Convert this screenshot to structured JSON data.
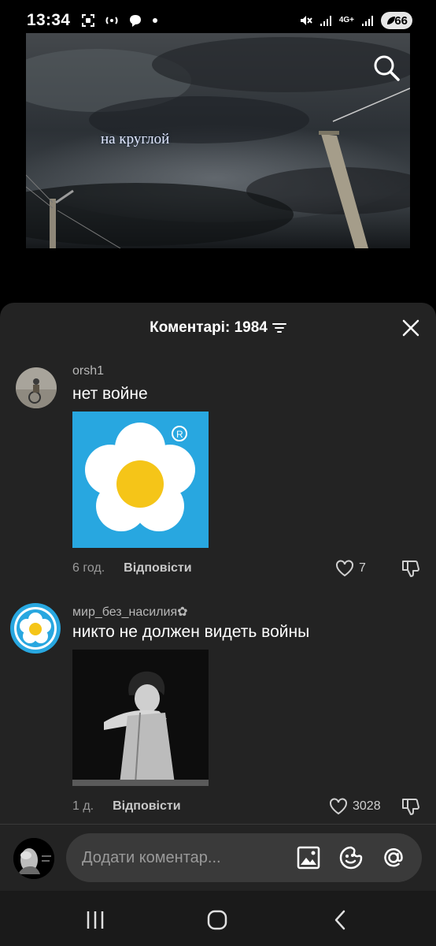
{
  "status": {
    "time": "13:34",
    "network": "4G+",
    "battery": "66"
  },
  "video": {
    "caption": "на круглой"
  },
  "comments_panel": {
    "title": "Коментарі: 1984"
  },
  "comments": [
    {
      "username": "orsh1",
      "text": "нет войне",
      "time": "6 год.",
      "reply_label": "Відповісти",
      "likes": "7"
    },
    {
      "username": "мир_без_насилия✿",
      "text": "никто не должен видеть войны",
      "time": "1 д.",
      "reply_label": "Відповісти",
      "likes": "3028"
    }
  ],
  "composer": {
    "placeholder": "Додати коментар..."
  },
  "colors": {
    "sheet_bg": "#232323",
    "pill_bg": "#3a3a3a",
    "sticker_blue": "#28a7e0",
    "flower_center": "#f5c518"
  },
  "icons": [
    "search-icon",
    "sort-icon",
    "close-icon",
    "heart-icon",
    "dislike-icon",
    "image-icon",
    "emoji-icon",
    "mention-icon",
    "recents-icon",
    "home-icon",
    "back-icon"
  ]
}
